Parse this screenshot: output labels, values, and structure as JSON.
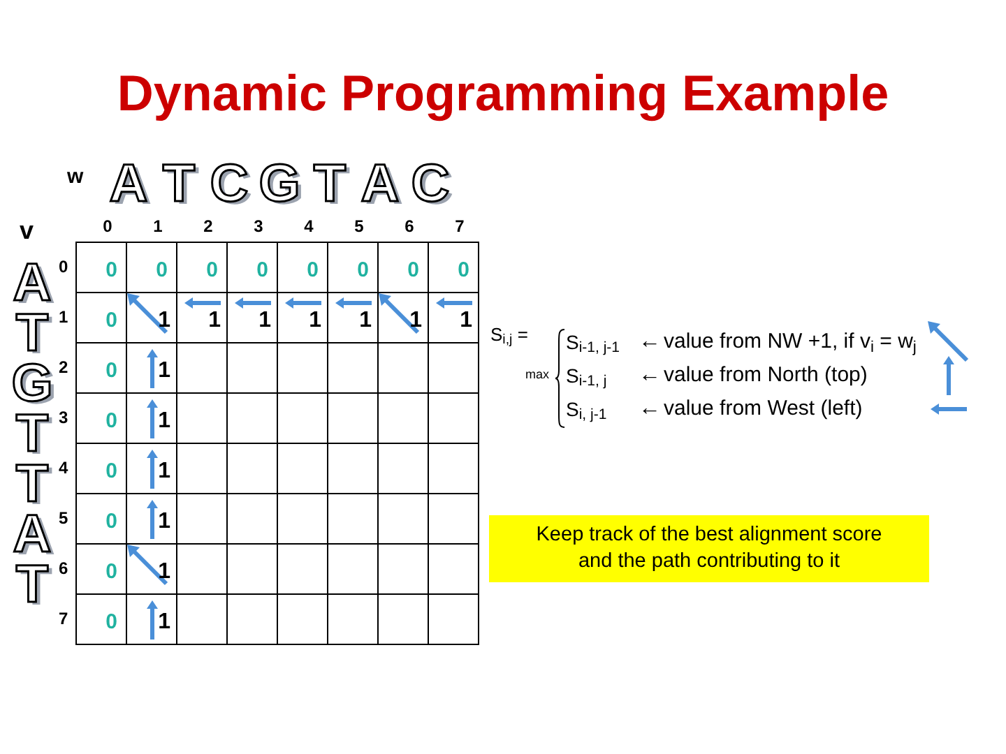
{
  "title": "Dynamic Programming Example",
  "sequence_w": {
    "label": "w",
    "letters": [
      "A",
      "T",
      "C",
      "G",
      "T",
      "A",
      "C"
    ]
  },
  "column_indices": [
    "0",
    "1",
    "2",
    "3",
    "4",
    "5",
    "6",
    "7"
  ],
  "sequence_v": {
    "label": "v",
    "letters": [
      "A",
      "T",
      "G",
      "T",
      "T",
      "A",
      "T"
    ]
  },
  "row_indices": [
    "0",
    "1",
    "2",
    "3",
    "4",
    "5",
    "6",
    "7"
  ],
  "grid": [
    [
      {
        "kind": "initial",
        "text": "0"
      },
      {
        "kind": "initial",
        "text": "0"
      },
      {
        "kind": "initial",
        "text": "0"
      },
      {
        "kind": "initial",
        "text": "0"
      },
      {
        "kind": "initial",
        "text": "0"
      },
      {
        "kind": "initial",
        "text": "0"
      },
      {
        "kind": "initial",
        "text": "0"
      },
      {
        "kind": "initial",
        "text": "0"
      }
    ],
    [
      {
        "kind": "initial",
        "text": "0"
      },
      {
        "kind": "score",
        "text": "1",
        "arrow": {
          "kind": "diag"
        }
      },
      {
        "kind": "score",
        "text": "1",
        "arrow": {
          "kind": "left"
        }
      },
      {
        "kind": "score",
        "text": "1",
        "arrow": {
          "kind": "left"
        }
      },
      {
        "kind": "score",
        "text": "1",
        "arrow": {
          "kind": "left"
        }
      },
      {
        "kind": "score",
        "text": "1",
        "arrow": {
          "kind": "left"
        }
      },
      {
        "kind": "score",
        "text": "1",
        "arrow": {
          "kind": "diag"
        }
      },
      {
        "kind": "score",
        "text": "1",
        "arrow": {
          "kind": "left"
        }
      }
    ],
    [
      {
        "kind": "initial",
        "text": "0"
      },
      {
        "kind": "score",
        "text": "1",
        "arrow": {
          "kind": "up"
        }
      },
      {
        "kind": "empty"
      },
      {
        "kind": "empty"
      },
      {
        "kind": "empty"
      },
      {
        "kind": "empty"
      },
      {
        "kind": "empty"
      },
      {
        "kind": "empty"
      }
    ],
    [
      {
        "kind": "initial",
        "text": "0"
      },
      {
        "kind": "score",
        "text": "1",
        "arrow": {
          "kind": "up"
        }
      },
      {
        "kind": "empty"
      },
      {
        "kind": "empty"
      },
      {
        "kind": "empty"
      },
      {
        "kind": "empty"
      },
      {
        "kind": "empty"
      },
      {
        "kind": "empty"
      }
    ],
    [
      {
        "kind": "initial",
        "text": "0"
      },
      {
        "kind": "score",
        "text": "1",
        "arrow": {
          "kind": "up"
        }
      },
      {
        "kind": "empty"
      },
      {
        "kind": "empty"
      },
      {
        "kind": "empty"
      },
      {
        "kind": "empty"
      },
      {
        "kind": "empty"
      },
      {
        "kind": "empty"
      }
    ],
    [
      {
        "kind": "initial",
        "text": "0"
      },
      {
        "kind": "score",
        "text": "1",
        "arrow": {
          "kind": "up"
        }
      },
      {
        "kind": "empty"
      },
      {
        "kind": "empty"
      },
      {
        "kind": "empty"
      },
      {
        "kind": "empty"
      },
      {
        "kind": "empty"
      },
      {
        "kind": "empty"
      }
    ],
    [
      {
        "kind": "initial",
        "text": "0"
      },
      {
        "kind": "score",
        "text": "1",
        "arrow": {
          "kind": "diag"
        }
      },
      {
        "kind": "empty"
      },
      {
        "kind": "empty"
      },
      {
        "kind": "empty"
      },
      {
        "kind": "empty"
      },
      {
        "kind": "empty"
      },
      {
        "kind": "empty"
      }
    ],
    [
      {
        "kind": "initial",
        "text": "0"
      },
      {
        "kind": "score",
        "text": "1",
        "arrow": {
          "kind": "up"
        }
      },
      {
        "kind": "empty"
      },
      {
        "kind": "empty"
      },
      {
        "kind": "empty"
      },
      {
        "kind": "empty"
      },
      {
        "kind": "empty"
      },
      {
        "kind": "empty"
      }
    ]
  ],
  "formula": {
    "lhs": "S$_{i,j}$ =",
    "operator": "max",
    "cases": [
      {
        "term": "S$_{i-1, j-1}$",
        "pointer": "←",
        "description": "value from NW +1, if v$_{i}$ = w$_{j}$",
        "arrow": {
          "kind": "diag"
        }
      },
      {
        "term": "S$_{i-1, j}$",
        "pointer": "←",
        "description": "value from North (top)",
        "arrow": {
          "kind": "up"
        }
      },
      {
        "term": "S$_{i, j-1}$",
        "pointer": "←",
        "description": "value from West (left)",
        "arrow": {
          "kind": "left"
        }
      }
    ]
  },
  "note": "Keep track of the best alignment score and the path contributing to it"
}
